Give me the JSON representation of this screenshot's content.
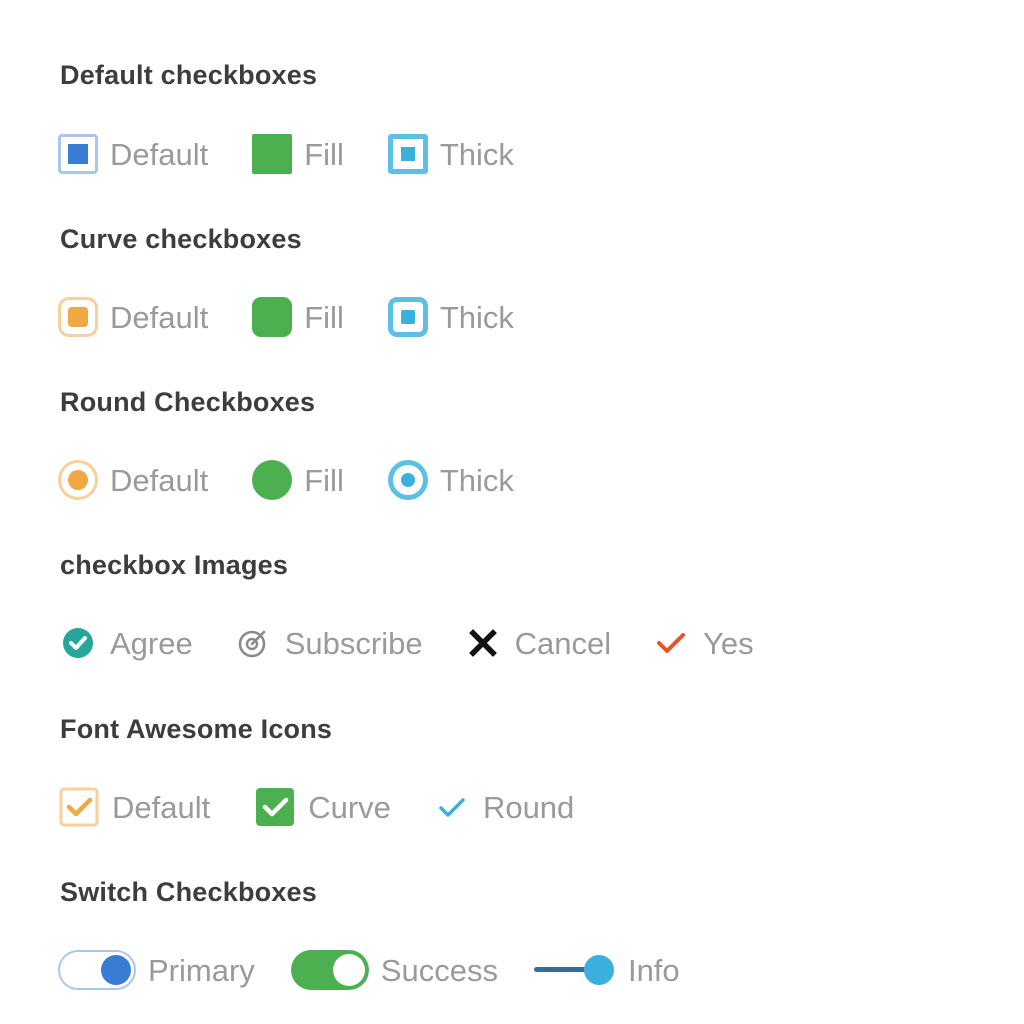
{
  "sections": [
    {
      "title": "Default checkboxes",
      "items": [
        {
          "label": "Default",
          "icon": "square-checkbox-default-icon",
          "color": "#3a7bd5"
        },
        {
          "label": "Fill",
          "icon": "square-checkbox-fill-icon",
          "color": "#4caf50"
        },
        {
          "label": "Thick",
          "icon": "square-checkbox-thick-icon",
          "color": "#3bb0dc"
        }
      ]
    },
    {
      "title": "Curve checkboxes",
      "items": [
        {
          "label": "Default",
          "icon": "curve-checkbox-default-icon",
          "color": "#f0a844"
        },
        {
          "label": "Fill",
          "icon": "curve-checkbox-fill-icon",
          "color": "#4caf50"
        },
        {
          "label": "Thick",
          "icon": "curve-checkbox-thick-icon",
          "color": "#3bb0dc"
        }
      ]
    },
    {
      "title": "Round Checkboxes",
      "items": [
        {
          "label": "Default",
          "icon": "round-checkbox-default-icon",
          "color": "#f0a844"
        },
        {
          "label": "Fill",
          "icon": "round-checkbox-fill-icon",
          "color": "#4caf50"
        },
        {
          "label": "Thick",
          "icon": "round-checkbox-thick-icon",
          "color": "#3bb0dc"
        }
      ]
    },
    {
      "title": "checkbox Images",
      "items": [
        {
          "label": "Agree",
          "icon": "check-circle-icon",
          "color": "#26a69a"
        },
        {
          "label": "Subscribe",
          "icon": "target-check-icon",
          "color": "#888888"
        },
        {
          "label": "Cancel",
          "icon": "cross-icon",
          "color": "#111111"
        },
        {
          "label": "Yes",
          "icon": "checkmark-icon",
          "color": "#e8532e"
        }
      ]
    },
    {
      "title": "Font Awesome Icons",
      "items": [
        {
          "label": "Default",
          "icon": "fa-check-square-outline-icon",
          "color": "#f0a844"
        },
        {
          "label": "Curve",
          "icon": "fa-check-square-fill-icon",
          "color": "#4caf50"
        },
        {
          "label": "Round",
          "icon": "fa-check-icon",
          "color": "#3bb0dc"
        }
      ]
    },
    {
      "title": "Switch Checkboxes",
      "items": [
        {
          "label": "Primary",
          "icon": "toggle-switch-icon",
          "color": "#3a7bd5"
        },
        {
          "label": "Success",
          "icon": "toggle-switch-icon",
          "color": "#4caf50"
        },
        {
          "label": "Info",
          "icon": "slider-switch-icon",
          "color": "#3bb0dc"
        }
      ]
    }
  ]
}
